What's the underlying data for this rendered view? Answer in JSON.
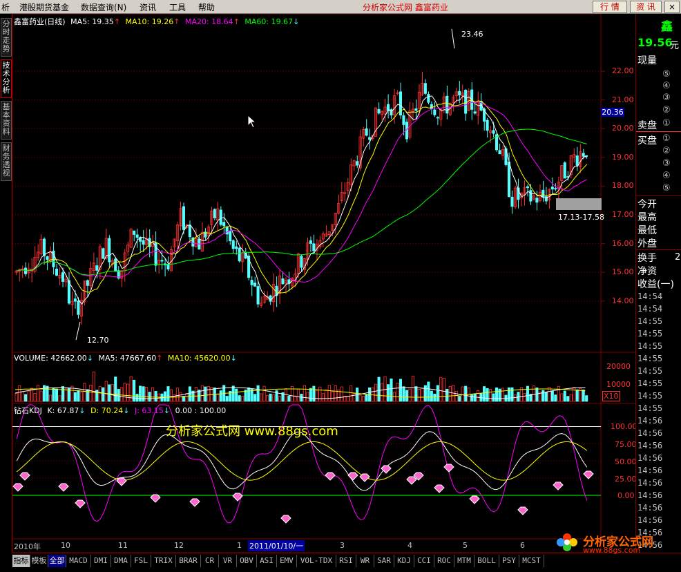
{
  "menubar": {
    "items": [
      "析",
      "港股期货基金",
      "数据查询(N)",
      "资讯",
      "工具",
      "帮助"
    ],
    "title": "分析家公式网  鑫富药业",
    "btn_quote": "行 情",
    "btn_news": "资 讯",
    "btn_close": "×"
  },
  "lefttabs": [
    "分时走势",
    "技术分析",
    "基本资料",
    "财务透视"
  ],
  "main": {
    "stock": "鑫富药业(日线)",
    "ma5": "MA5: 19.35",
    "ma10": "MA10: 19.26",
    "ma20": "MA20: 18.64",
    "ma60": "MA60: 19.67",
    "price_labels": [
      "22.00",
      "21.00",
      "20.00",
      "19.00",
      "18.00",
      "17.00",
      "16.00",
      "15.00",
      "14.00"
    ],
    "current_price_tag": "20.36",
    "high_label": "23.46",
    "low_label": "12.70",
    "range_label": "17.13-17.58"
  },
  "volume": {
    "title": "VOLUME: 42662.00",
    "ma5": "MA5: 47667.60",
    "ma10": "MA10: 45620.00",
    "labels": [
      "20000",
      "10000"
    ],
    "unit": "X10"
  },
  "kdj": {
    "title": "钻石KDJ",
    "k": "K: 67.87",
    "d": "D: 70.24",
    "j": "J: 63.15",
    "extra": "0.00 : 100.00",
    "labels": [
      "100.00",
      "75.00",
      "50.00",
      "25.00",
      "0.00"
    ]
  },
  "watermark": "分析家公式网 www.88gs.com",
  "dates": {
    "labels": [
      "2010年",
      "10",
      "11",
      "12",
      "1",
      "2011/01/10/一",
      "3",
      "4",
      "5",
      "6"
    ]
  },
  "bottomtabs": [
    "指标",
    "模板",
    "全部",
    "MACD",
    "DMI",
    "DMA",
    "FSL",
    "TRIX",
    "BRAR",
    "CR",
    "VR",
    "OBV",
    "ASI",
    "EMV",
    "VOL-TDX",
    "RSI",
    "WR",
    "SAR",
    "KDJ",
    "CCI",
    "ROC",
    "MTM",
    "BOLL",
    "PSY",
    "MCST"
  ],
  "rightpanel": {
    "name": "鑫",
    "price": "19.56",
    "price_unit": "元",
    "now": "现量",
    "sell_items": [
      "⑤",
      "④",
      "③",
      "②",
      "①"
    ],
    "sell_label": "卖盘",
    "buy_label": "买盘",
    "buy_items": [
      "①",
      "②",
      "③",
      "④",
      "⑤"
    ],
    "stats": [
      "今开",
      "最高",
      "最低",
      "外盘",
      "换手",
      "净资",
      "收益(一)"
    ],
    "stat_extra": "2",
    "times": [
      "14:54",
      "14:54",
      "14:55",
      "14:55",
      "14:55",
      "14:55",
      "14:55",
      "14:55",
      "14:55",
      "14:55",
      "14:56",
      "14:56",
      "14:56",
      "14:56",
      "14:56",
      "14:56",
      "14:56",
      "14:56",
      "14:56",
      "14:56",
      "14:56"
    ]
  },
  "logo": {
    "name": "分析家公式网",
    "url": "www.88gs.com"
  },
  "colors": {
    "ma5": "#ffffff",
    "ma10": "#ffff00",
    "ma20": "#ff00ff",
    "ma60": "#00ff00",
    "up": "#ff3232",
    "down": "#54ffff",
    "grid": "#800000"
  }
}
